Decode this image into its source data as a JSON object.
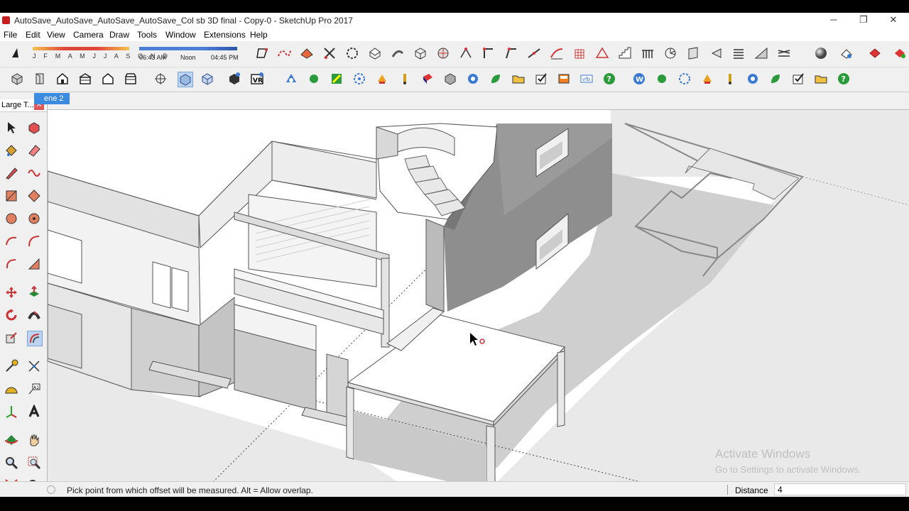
{
  "window": {
    "title": "AutoSave_AutoSave_AutoSave_AutoSave_Col sb 3D  final - Copy-0 - SketchUp Pro 2017",
    "controls": {
      "minimize": "─",
      "restore": "❐",
      "close": "✕"
    }
  },
  "menu": [
    "File",
    "Edit",
    "View",
    "Camera",
    "Draw",
    "Tools",
    "Window",
    "Extensions",
    "Help"
  ],
  "shadows": {
    "months": "J F M A M J J A S O N D",
    "time_start": "06:43 AM",
    "time_mid": "Noon",
    "time_end": "04:45 PM"
  },
  "scene_tab": {
    "label": "ene 2"
  },
  "left_panel": {
    "title": "Large T...",
    "close": "✕"
  },
  "viewport": {
    "cursor_icon": "push-pull-cursor"
  },
  "watermark": {
    "line1": "Activate Windows",
    "line2": "Go to Settings to activate Windows."
  },
  "status": {
    "message": "Pick point from which offset will be measured. Alt = Allow overlap.",
    "vcb_label": "Distance",
    "vcb_value": "4"
  },
  "colors": {
    "accent": "#3c8be0",
    "toolbar_bg": "#f0f0f0"
  }
}
